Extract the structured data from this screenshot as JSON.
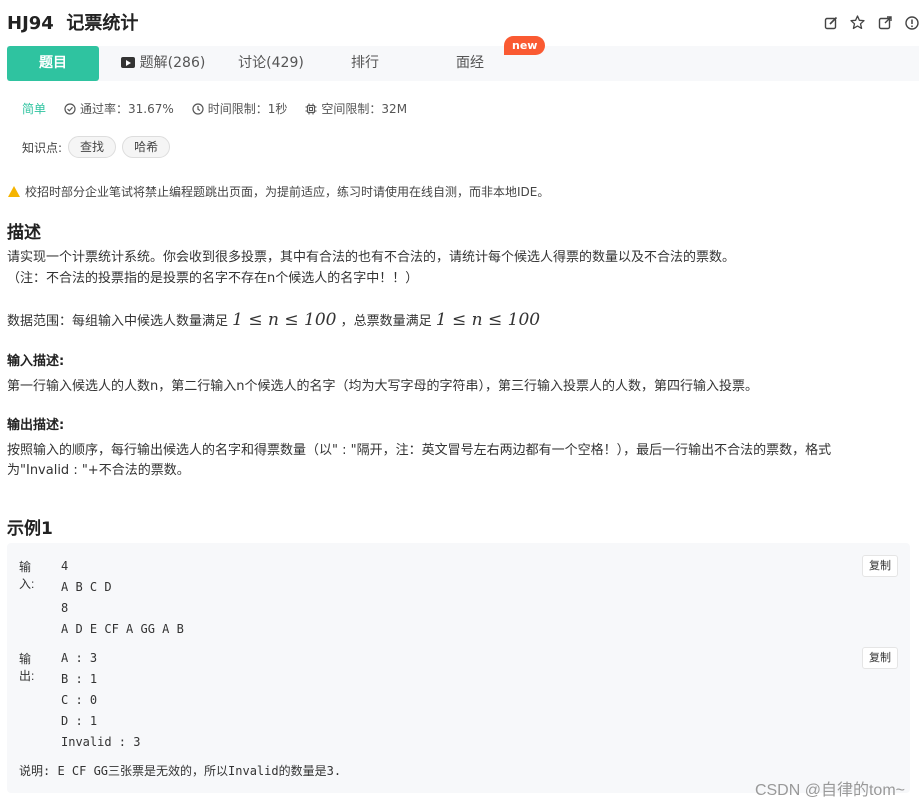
{
  "problem": {
    "id": "HJ94",
    "title": "记票统计"
  },
  "tabs": [
    {
      "label": "题目"
    },
    {
      "label": "题解(286)"
    },
    {
      "label": "讨论(429)"
    },
    {
      "label": "排行"
    },
    {
      "label": "面经"
    }
  ],
  "badge_new": "new",
  "meta": {
    "difficulty": "简单",
    "pass_rate": "通过率：31.67%",
    "time_limit": "时间限制：1秒",
    "space_limit": "空间限制：32M"
  },
  "knowledge": {
    "label": "知识点:",
    "tags": [
      "查找",
      "哈希"
    ]
  },
  "warning": "校招时部分企业笔试将禁止编程题跳出页面，为提前适应，练习时请使用在线自测，而非本地IDE。",
  "description": {
    "heading": "描述",
    "line1": "请实现一个计票统计系统。你会收到很多投票，其中有合法的也有不合法的，请统计每个候选人得票的数量以及不合法的票数。",
    "line2": "（注：不合法的投票指的是投票的名字不存在n个候选人的名字中！！）",
    "range_prefix": "数据范围：每组输入中候选人数量满足",
    "range_math1": "1 ≤ n ≤ 100",
    "range_mid": "，总票数量满足",
    "range_math2": "1 ≤ n ≤ 100"
  },
  "input_desc": {
    "heading": "输入描述:",
    "text": "第一行输入候选人的人数n，第二行输入n个候选人的名字（均为大写字母的字符串），第三行输入投票人的人数，第四行输入投票。"
  },
  "output_desc": {
    "heading": "输出描述:",
    "line1": "按照输入的顺序，每行输出候选人的名字和得票数量（以\" : \"隔开，注：英文冒号左右两边都有一个空格！），最后一行输出不合法的票数，格式",
    "line2": "为\"Invalid : \"+不合法的票数。"
  },
  "example": {
    "heading": "示例1",
    "input_label": "输入:",
    "input_lines": [
      "4",
      "A B C D",
      "8",
      "A D E CF A GG A B"
    ],
    "output_label": "输出:",
    "output_lines": [
      "A : 3",
      "B : 1",
      "C : 0",
      "D : 1",
      "Invalid : 3"
    ],
    "copy_label": "复制",
    "note": "说明: E CF GG三张票是无效的，所以Invalid的数量是3."
  },
  "watermark": "CSDN @自律的tom~"
}
